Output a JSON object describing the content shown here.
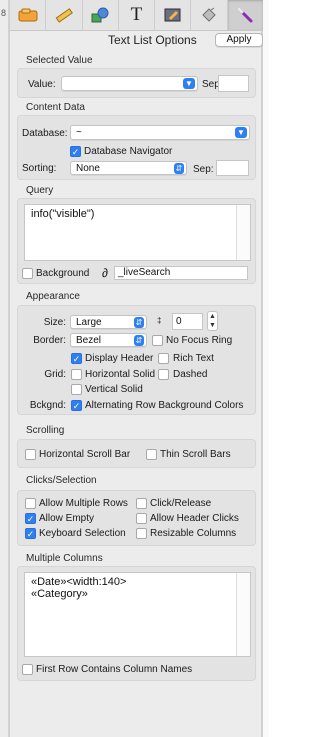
{
  "edge_left": {
    "glyph_top": "8",
    "glyph_bottom": ""
  },
  "toolbar": {
    "tools": [
      {
        "name": "picture-tool",
        "icon": "picture-icon"
      },
      {
        "name": "ruler-tool",
        "icon": "ruler-icon"
      },
      {
        "name": "shapes-tool",
        "icon": "shapes-icon"
      },
      {
        "name": "text-tool",
        "icon": "text-icon",
        "glyph": "T"
      },
      {
        "name": "edit-tool",
        "icon": "edit-icon"
      },
      {
        "name": "fill-tool",
        "icon": "fill-bucket-icon"
      },
      {
        "name": "wand-tool",
        "icon": "magic-wand-icon"
      }
    ],
    "active_index": 6
  },
  "panel": {
    "title": "Text List Options",
    "apply_label": "Apply"
  },
  "selected_value": {
    "section_label": "Selected Value",
    "value_label": "Value:",
    "value": "",
    "sep_label": "Sep:",
    "sep_value": ""
  },
  "content_data": {
    "section_label": "Content Data",
    "database_label": "Database:",
    "database_value": "~",
    "navigator_label": "Database Navigator",
    "navigator_checked": true,
    "sorting_label": "Sorting:",
    "sorting_value": "None",
    "sep_label": "Sep:",
    "sep_value": ""
  },
  "query": {
    "section_label": "Query",
    "text": "info(\"visible\")",
    "background_label": "Background",
    "background_checked": false,
    "live_search_symbol": "∂",
    "live_search_value": "_liveSearch"
  },
  "appearance": {
    "section_label": "Appearance",
    "size_label": "Size:",
    "size_value": "Large",
    "size_number_symbol": "‡",
    "size_number": "0",
    "border_label": "Border:",
    "border_value": "Bezel",
    "no_focus_ring_label": "No Focus Ring",
    "no_focus_ring_checked": false,
    "display_header_label": "Display Header",
    "display_header_checked": true,
    "rich_text_label": "Rich Text",
    "rich_text_checked": false,
    "grid_label": "Grid:",
    "horizontal_solid_label": "Horizontal Solid",
    "horizontal_solid_checked": false,
    "dashed_label": "Dashed",
    "dashed_checked": false,
    "vertical_solid_label": "Vertical Solid",
    "vertical_solid_checked": false,
    "bckgnd_label": "Bckgnd:",
    "alternating_label": "Alternating Row Background Colors",
    "alternating_checked": true
  },
  "scrolling": {
    "section_label": "Scrolling",
    "horizontal_label": "Horizontal Scroll Bar",
    "horizontal_checked": false,
    "thin_label": "Thin Scroll Bars",
    "thin_checked": false
  },
  "clicks": {
    "section_label": "Clicks/Selection",
    "allow_multiple_label": "Allow Multiple Rows",
    "allow_multiple_checked": false,
    "click_release_label": "Click/Release",
    "click_release_checked": false,
    "allow_empty_label": "Allow Empty",
    "allow_empty_checked": true,
    "allow_header_label": "Allow Header Clicks",
    "allow_header_checked": false,
    "keyboard_label": "Keyboard Selection",
    "keyboard_checked": true,
    "resizable_label": "Resizable Columns",
    "resizable_checked": false
  },
  "multiple_columns": {
    "section_label": "Multiple Columns",
    "line1": "«Date»<width:140>",
    "line2": "«Category»",
    "first_row_label": "First Row Contains Column Names",
    "first_row_checked": false
  },
  "colors": {
    "accent": "#2f7ff4",
    "panel_bg": "#ececec",
    "group_bg": "#e3e3e3"
  }
}
